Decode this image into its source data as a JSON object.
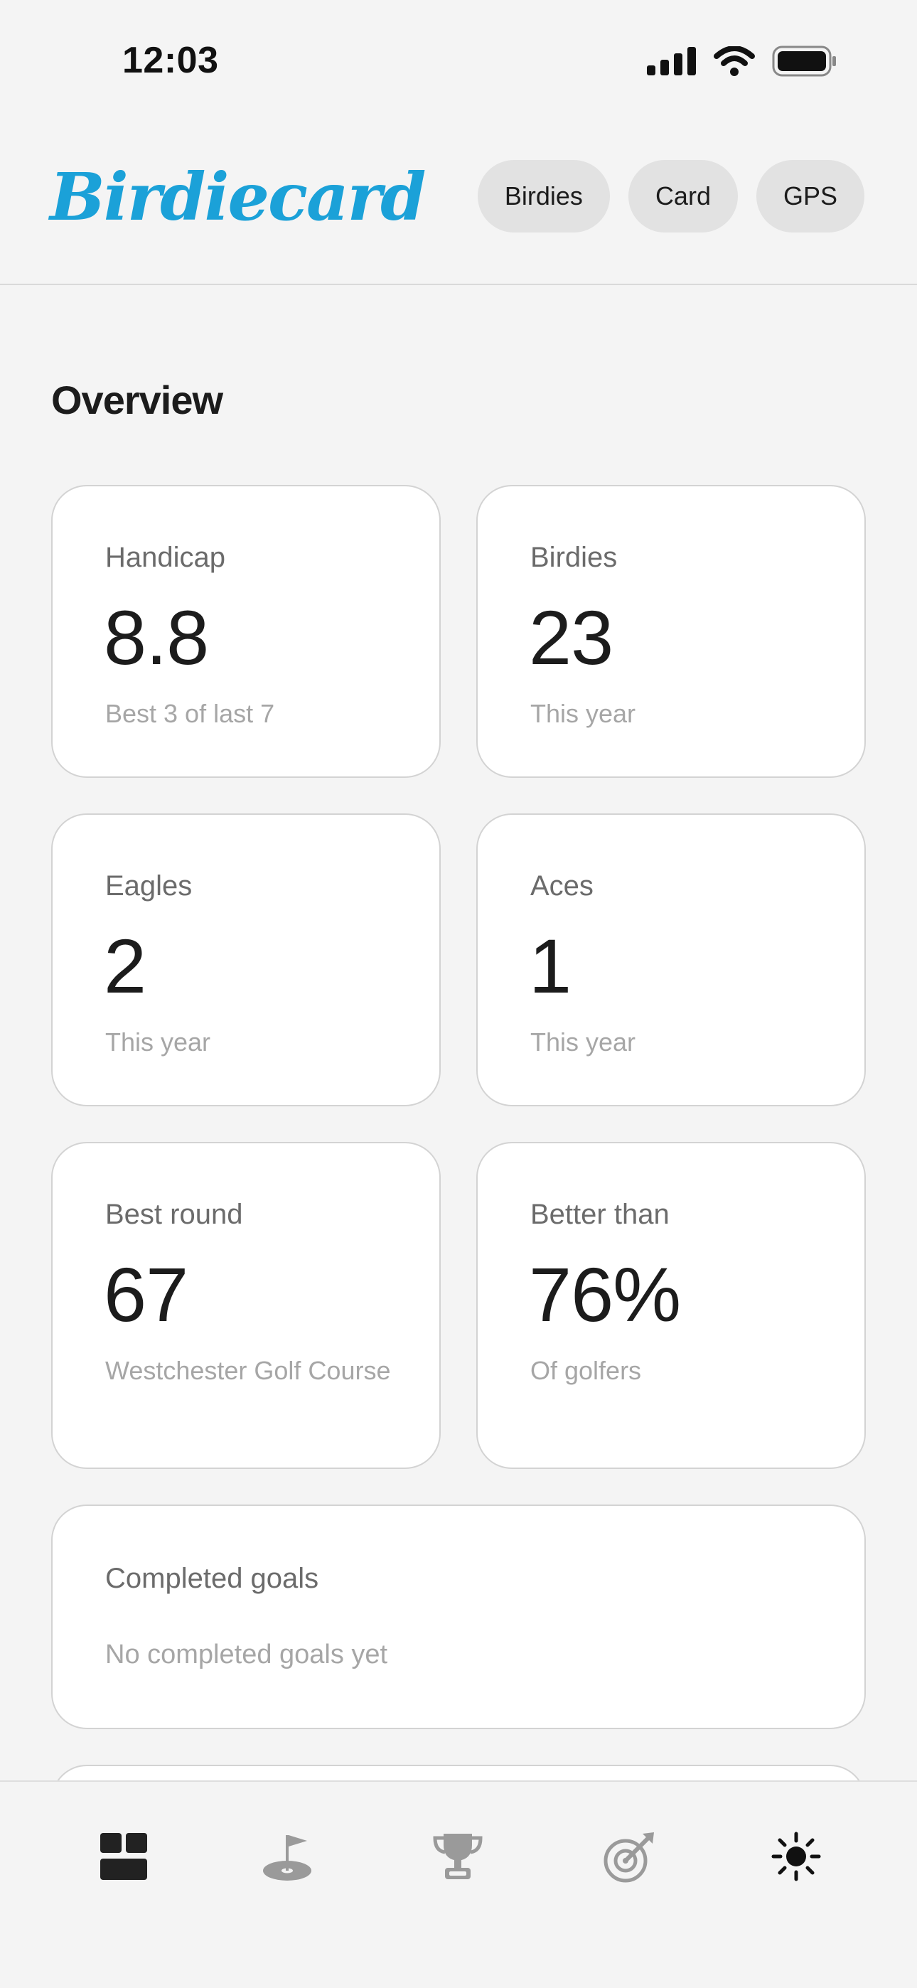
{
  "status_bar": {
    "time": "12:03"
  },
  "header": {
    "logo": "Birdiecard",
    "buttons": [
      {
        "label": "Birdies"
      },
      {
        "label": "Card"
      },
      {
        "label": "GPS"
      }
    ]
  },
  "overview": {
    "title": "Overview",
    "cards": [
      {
        "label": "Handicap",
        "value": "8.8",
        "sub": "Best 3 of last 7"
      },
      {
        "label": "Birdies",
        "value": "23",
        "sub": "This year"
      },
      {
        "label": "Eagles",
        "value": "2",
        "sub": "This year"
      },
      {
        "label": "Aces",
        "value": "1",
        "sub": "This year"
      },
      {
        "label": "Best round",
        "value": "67",
        "sub": "Westchester Golf Course"
      },
      {
        "label": "Better than",
        "value": "76%",
        "sub": "Of golfers"
      }
    ],
    "goals": {
      "label": "Completed goals",
      "empty_text": "No completed goals yet"
    }
  },
  "tab_bar": {
    "tabs": [
      {
        "icon": "dashboard-icon",
        "active": true
      },
      {
        "icon": "golf-flag-icon",
        "active": false
      },
      {
        "icon": "trophy-icon",
        "active": false
      },
      {
        "icon": "target-icon",
        "active": false
      },
      {
        "icon": "sun-icon",
        "active": false
      }
    ]
  },
  "colors": {
    "brand": "#1ba1d8",
    "background": "#f4f4f4",
    "card": "#ffffff",
    "muted": "#a6a6a6"
  }
}
